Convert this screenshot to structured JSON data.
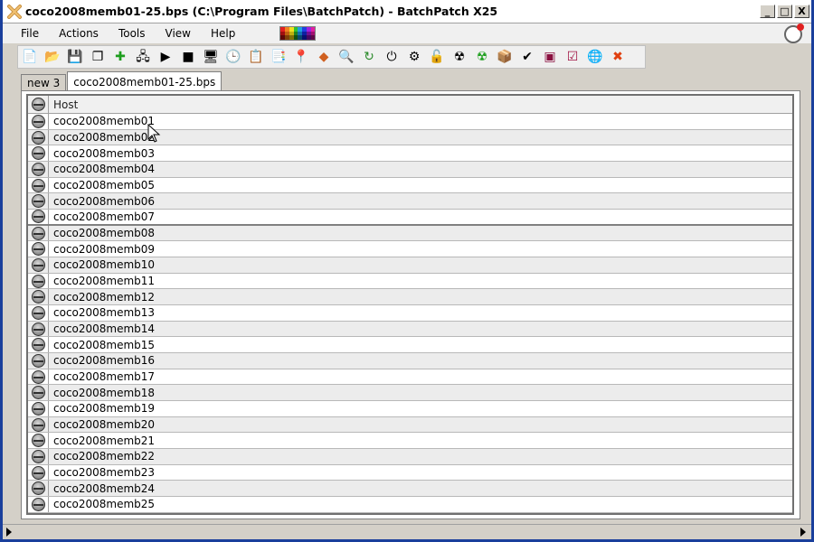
{
  "window": {
    "title": "coco2008memb01-25.bps (C:\\Program Files\\BatchPatch) - BatchPatch X25",
    "minimize_label": "_",
    "maximize_label": "□",
    "close_label": "X"
  },
  "menu": {
    "items": [
      "File",
      "Actions",
      "Tools",
      "View",
      "Help"
    ]
  },
  "toolbar": {
    "buttons": [
      {
        "name": "new-icon",
        "glyph": "📄"
      },
      {
        "name": "open-icon",
        "glyph": "📂"
      },
      {
        "name": "save-icon",
        "glyph": "💾"
      },
      {
        "name": "copy-icon",
        "glyph": "❐"
      },
      {
        "name": "add-host-icon",
        "glyph": "✚"
      },
      {
        "name": "network-icon",
        "glyph": "🖧"
      },
      {
        "name": "play-icon",
        "glyph": "▶"
      },
      {
        "name": "stop-icon",
        "glyph": "■"
      },
      {
        "name": "remote-desktop-icon",
        "glyph": "🖥"
      },
      {
        "name": "clock-icon",
        "glyph": "🕒"
      },
      {
        "name": "report-icon",
        "glyph": "📋"
      },
      {
        "name": "deploy-icon",
        "glyph": "📑"
      },
      {
        "name": "location-pin-icon",
        "glyph": "📍"
      },
      {
        "name": "diamond-icon",
        "glyph": "◆"
      },
      {
        "name": "search-icon",
        "glyph": "🔍"
      },
      {
        "name": "refresh-icon",
        "glyph": "↻"
      },
      {
        "name": "power-icon",
        "glyph": "⏻"
      },
      {
        "name": "gear-icon",
        "glyph": "⚙"
      },
      {
        "name": "unlock-icon",
        "glyph": "🔓"
      },
      {
        "name": "radiation-icon",
        "glyph": "☢"
      },
      {
        "name": "radiation-green-icon",
        "glyph": "☢"
      },
      {
        "name": "package-icon",
        "glyph": "📦"
      },
      {
        "name": "check-package-icon",
        "glyph": "✔"
      },
      {
        "name": "terminal-icon",
        "glyph": "▣"
      },
      {
        "name": "check-box-icon",
        "glyph": "☑"
      },
      {
        "name": "globe-icon",
        "glyph": "🌐"
      },
      {
        "name": "delete-icon",
        "glyph": "✖"
      }
    ]
  },
  "tabs": [
    {
      "label": "new 3",
      "active": false
    },
    {
      "label": "coco2008memb01-25.bps",
      "active": true
    }
  ],
  "grid": {
    "column_host": "Host",
    "rows": [
      "coco2008memb01",
      "coco2008memb02",
      "coco2008memb03",
      "coco2008memb04",
      "coco2008memb05",
      "coco2008memb06",
      "coco2008memb07",
      "coco2008memb08",
      "coco2008memb09",
      "coco2008memb10",
      "coco2008memb11",
      "coco2008memb12",
      "coco2008memb13",
      "coco2008memb14",
      "coco2008memb15",
      "coco2008memb16",
      "coco2008memb17",
      "coco2008memb18",
      "coco2008memb19",
      "coco2008memb20",
      "coco2008memb21",
      "coco2008memb22",
      "coco2008memb23",
      "coco2008memb24",
      "coco2008memb25"
    ]
  },
  "colors": {
    "titlebar_border": "#1a3f9c",
    "window_bg": "#d4d0c8",
    "alt_row": "#ececec"
  }
}
